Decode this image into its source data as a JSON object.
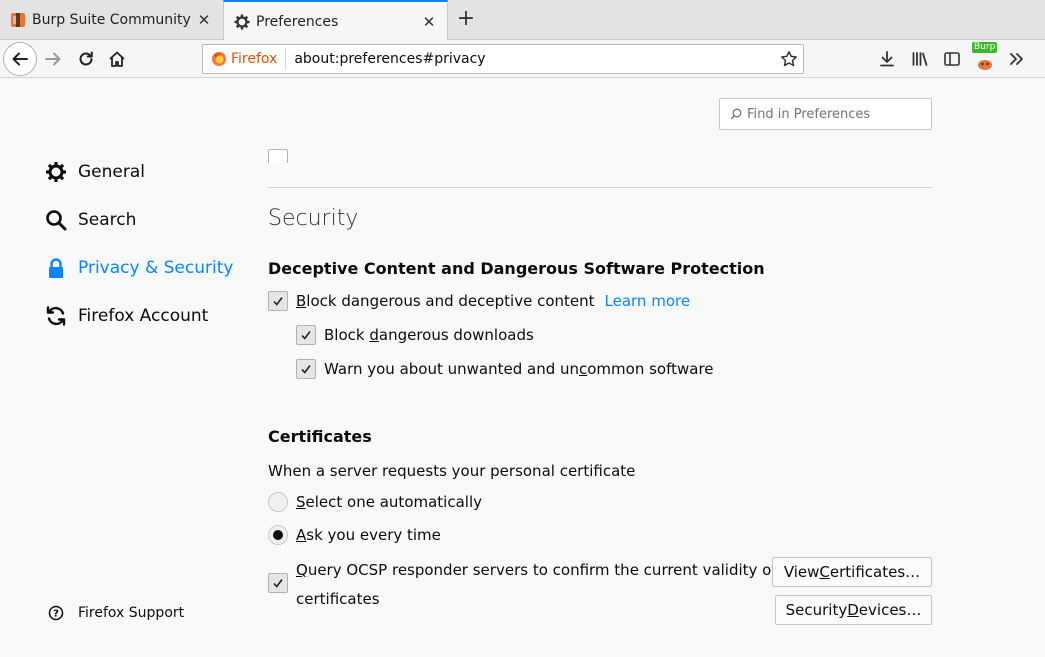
{
  "tabs": [
    {
      "title": "Burp Suite Community Ed",
      "favicon": "burp-icon",
      "active": false
    },
    {
      "title": "Preferences",
      "favicon": "gear-icon",
      "active": true
    }
  ],
  "navbar": {
    "identity_label": "Firefox",
    "url": "about:preferences#privacy",
    "burp_badge": "Burp"
  },
  "search": {
    "placeholder": "Find in Preferences"
  },
  "sidebar": {
    "items": [
      {
        "label": "General",
        "icon": "gear-icon"
      },
      {
        "label": "Search",
        "icon": "search-icon"
      },
      {
        "label": "Privacy & Security",
        "icon": "lock-icon",
        "selected": true
      },
      {
        "label": "Firefox Account",
        "icon": "sync-icon"
      }
    ],
    "support_label": "Firefox Support"
  },
  "security": {
    "heading": "Security",
    "deceptive": {
      "heading": "Deceptive Content and Dangerous Software Protection",
      "block_dangerous": {
        "pre": "",
        "accel": "B",
        "post": "lock dangerous and deceptive content",
        "checked": true
      },
      "learn_more": "Learn more",
      "block_downloads": {
        "pre": "Block ",
        "accel": "d",
        "post": "angerous downloads",
        "checked": true
      },
      "warn_unwanted": {
        "pre": "Warn you about unwanted and un",
        "accel": "c",
        "post": "ommon software",
        "checked": true
      }
    },
    "certificates": {
      "heading": "Certificates",
      "prompt": "When a server requests your personal certificate",
      "select_auto": {
        "pre": "",
        "accel": "S",
        "post": "elect one automatically",
        "selected": false
      },
      "ask_every": {
        "pre": "",
        "accel": "A",
        "post": "sk you every time",
        "selected": true
      },
      "ocsp": {
        "pre": "",
        "accel": "Q",
        "post": "uery OCSP responder servers to confirm the current validity of",
        "line2": "certificates",
        "checked": true
      },
      "view_certificates": {
        "pre": "View ",
        "accel": "C",
        "post": "ertificates…"
      },
      "security_devices": {
        "pre": "Security ",
        "accel": "D",
        "post": "evices…"
      }
    }
  },
  "colors": {
    "accent": "#0a84ff",
    "identity": "#d7530a",
    "badge": "#3db82a"
  }
}
